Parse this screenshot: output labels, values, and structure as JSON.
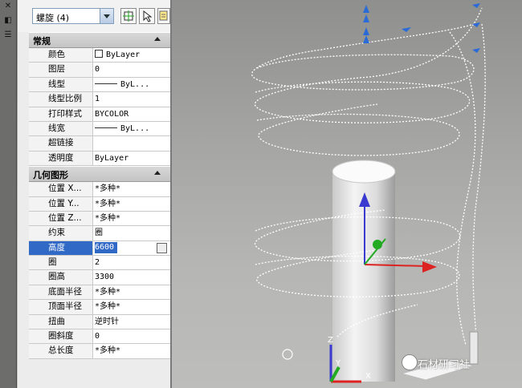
{
  "object_selector": {
    "value": "螺旋 (4)"
  },
  "sections": [
    {
      "title": "常规",
      "rows": [
        {
          "name": "颜色",
          "value": "ByLayer",
          "kind": "color"
        },
        {
          "name": "图层",
          "value": "0"
        },
        {
          "name": "线型",
          "value": "ByL...",
          "kind": "line"
        },
        {
          "name": "线型比例",
          "value": "1"
        },
        {
          "name": "打印样式",
          "value": "BYCOLOR"
        },
        {
          "name": "线宽",
          "value": "ByL...",
          "kind": "line"
        },
        {
          "name": "超链接",
          "value": ""
        },
        {
          "name": "透明度",
          "value": "ByLayer"
        }
      ]
    },
    {
      "title": "几何图形",
      "rows": [
        {
          "name": "位置 X...",
          "value": "*多种*"
        },
        {
          "name": "位置 Y...",
          "value": "*多种*"
        },
        {
          "name": "位置 Z...",
          "value": "*多种*"
        },
        {
          "name": "约束",
          "value": "圈"
        },
        {
          "name": "高度",
          "value": "6600",
          "selected": true
        },
        {
          "name": "圈",
          "value": "2"
        },
        {
          "name": "圈高",
          "value": "3300"
        },
        {
          "name": "底面半径",
          "value": "*多种*"
        },
        {
          "name": "顶面半径",
          "value": "*多种*"
        },
        {
          "name": "扭曲",
          "value": "逆时针"
        },
        {
          "name": "圈斜度",
          "value": "0"
        },
        {
          "name": "总长度",
          "value": "*多种*"
        }
      ]
    }
  ],
  "watermark": "石材研习社",
  "colors": {
    "selection": "#3169c6",
    "grip": "#2b6bd6",
    "axis_x": "#d22",
    "axis_y": "#2a2",
    "axis_z": "#33c"
  }
}
